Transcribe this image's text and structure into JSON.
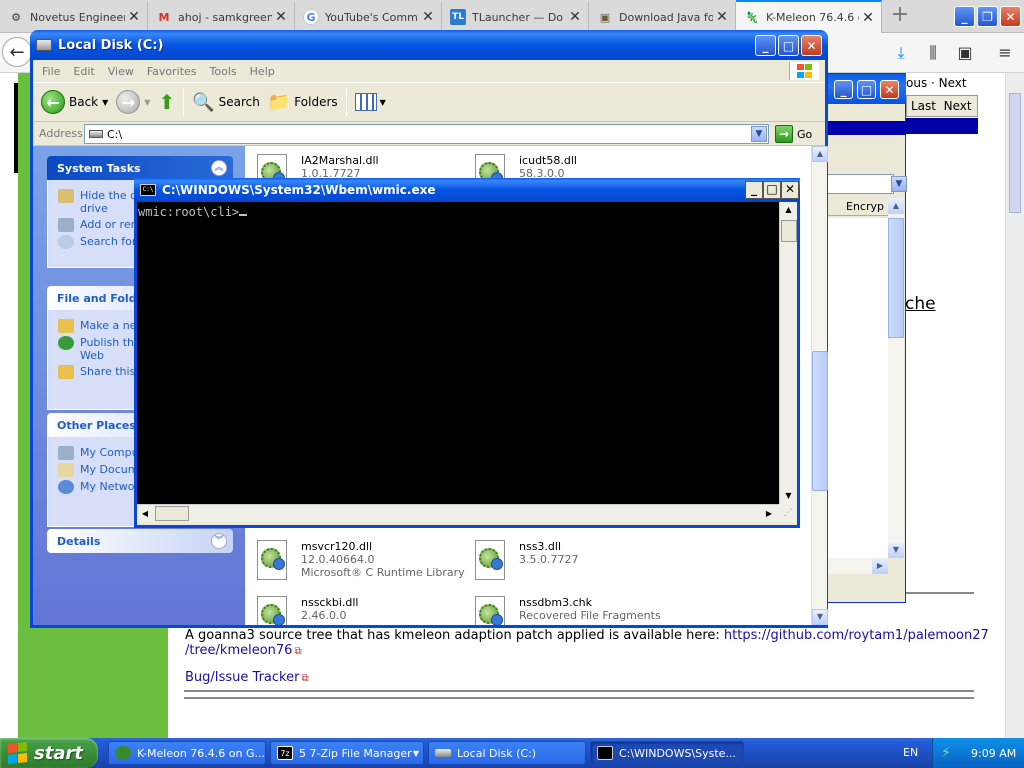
{
  "browser": {
    "tabs": [
      {
        "label": "Novetus Engineer",
        "icon": "gear-icon"
      },
      {
        "label": "ahoj - samkgreen",
        "icon": "gmail-icon"
      },
      {
        "label": "YouTube's Comm",
        "icon": "google-icon"
      },
      {
        "label": "TLauncher — Do",
        "icon": "tlauncher-icon"
      },
      {
        "label": "Download Java fo",
        "icon": "package-icon"
      },
      {
        "label": "K-Meleon 76.4.6 o",
        "icon": "kmeleon-icon"
      }
    ],
    "new_tab": "+",
    "page": {
      "ache_text": "che",
      "source_text": "A goanna3 source tree that has kmeleon adaption patch applied is available here: ",
      "source_link_line1": "https://github.com/roytam1/palemoon27",
      "source_link_line2": "/tree/kmeleon76",
      "tracker_link": "Bug/Issue Tracker"
    }
  },
  "help_dialog": {
    "prev_label": "ous",
    "next_label": "Next",
    "last_label": "Last",
    "next2_label": "Next",
    "col_header": "Encryp"
  },
  "explorer": {
    "title": "Local Disk (C:)",
    "menu": [
      "File",
      "Edit",
      "View",
      "Favorites",
      "Tools",
      "Help"
    ],
    "toolbar": {
      "back": "Back",
      "search": "Search",
      "folders": "Folders"
    },
    "address_label": "Address",
    "address_value": "C:\\",
    "go_label": "Go",
    "task_sections": {
      "system": {
        "title": "System Tasks",
        "links": [
          "Hide the co",
          "drive",
          "Add or rem",
          "Search for"
        ]
      },
      "file_folder": {
        "title": "File and Folde",
        "links": [
          "Make a new",
          "Publish this",
          "Web",
          "Share this"
        ]
      },
      "other": {
        "title": "Other Places",
        "links": [
          "My Compu",
          "My Docum",
          "My Networ"
        ]
      },
      "details": {
        "title": "Details"
      }
    },
    "files": [
      {
        "name": "IA2Marshal.dll",
        "sub1": "1.0.1.7727",
        "sub2": ""
      },
      {
        "name": "icudt58.dll",
        "sub1": "58.3.0.0",
        "sub2": ""
      },
      {
        "name": "msvcr120.dll",
        "sub1": "12.0.40664.0",
        "sub2": "Microsoft® C Runtime Library"
      },
      {
        "name": "nss3.dll",
        "sub1": "3.5.0.7727",
        "sub2": ""
      },
      {
        "name": "nssckbi.dll",
        "sub1": "2.46.0.0",
        "sub2": ""
      },
      {
        "name": "nssdbm3.chk",
        "sub1": "Recovered File Fragments",
        "sub2": ""
      }
    ]
  },
  "console": {
    "title": "C:\\WINDOWS\\System32\\Wbem\\wmic.exe",
    "prompt": "wmic:root\\cli>"
  },
  "taskbar": {
    "start_label": "start",
    "items": [
      {
        "label": "K-Meleon 76.4.6 on G..."
      },
      {
        "label": "5 7-Zip File Manager"
      },
      {
        "label": "Local Disk (C:)"
      },
      {
        "label": "C:\\WINDOWS\\Syste..."
      }
    ],
    "language": "EN",
    "clock": "9:09 AM"
  },
  "colors": {
    "xp_title_blue": "#0655e4",
    "page_green": "#6cbe3e",
    "taskbar_blue": "#245edb",
    "start_green": "#3a8e3a"
  }
}
